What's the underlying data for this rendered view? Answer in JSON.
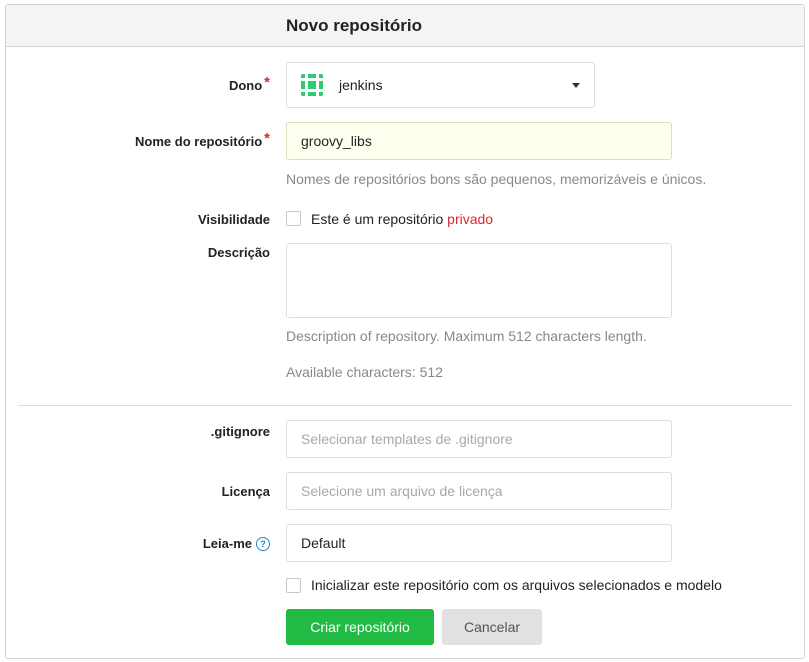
{
  "header": {
    "title": "Novo repositório"
  },
  "owner": {
    "label": "Dono",
    "required_mark": "*",
    "value": "jenkins"
  },
  "repo_name": {
    "label": "Nome do repositório",
    "required_mark": "*",
    "value": "groovy_libs",
    "hint": "Nomes de repositórios bons são pequenos, memorizáveis e únicos."
  },
  "visibility": {
    "label": "Visibilidade",
    "checkbox_text": "Este é um repositório ",
    "private_word": "privado",
    "checked": false
  },
  "description": {
    "label": "Descrição",
    "value": "",
    "hint": "Description of repository. Maximum 512 characters length.",
    "available": "Available characters: 512"
  },
  "gitignore": {
    "label": ".gitignore",
    "placeholder": "Selecionar templates de .gitignore"
  },
  "license": {
    "label": "Licença",
    "placeholder": "Selecione um arquivo de licença"
  },
  "readme": {
    "label": "Leia-me",
    "help_icon": "?",
    "value": "Default"
  },
  "init": {
    "checkbox_text": "Inicializar este repositório com os arquivos selecionados e modelo",
    "checked": false
  },
  "buttons": {
    "create": "Criar repositório",
    "cancel": "Cancelar"
  },
  "colors": {
    "primary": "#21ba45",
    "danger": "#db2828",
    "secondary": "#e0e1e2"
  }
}
